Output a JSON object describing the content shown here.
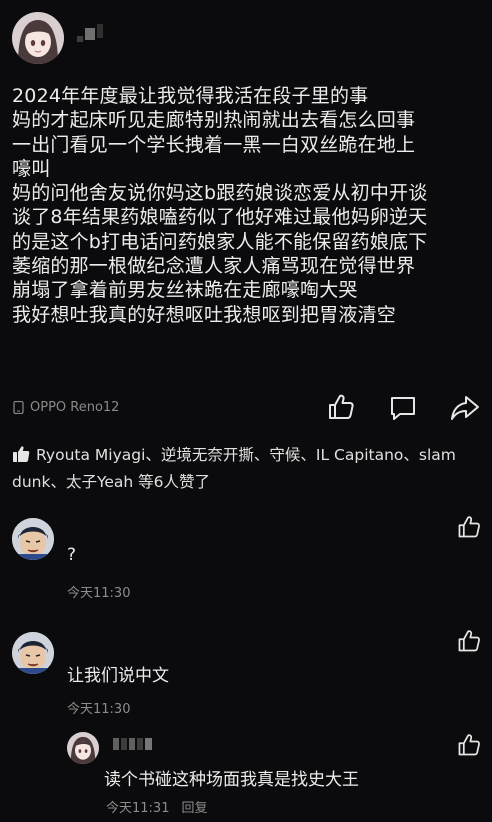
{
  "post": {
    "author_avatar": "anime-girl-avatar",
    "lines": [
      "2024年年度最让我觉得我活在段子里的事",
      "妈的才起床听见走廊特别热闹就出去看怎么回事",
      "一出门看见一个学长拽着一黑一白双丝跪在地上",
      "嚎叫",
      "妈的问他舍友说你妈这b跟药娘谈恋爱从初中开谈",
      "谈了8年结果药娘嗑药似了他好难过最他妈卵逆天",
      "的是这个b打电话问药娘家人能不能保留药娘底下",
      "萎缩的那一根做纪念遭人家人痛骂现在觉得世界",
      "崩塌了拿着前男友丝袜跪在走廊嚎啕大哭",
      "我好想吐我真的好想呕吐我想呕到把胃液清空"
    ],
    "device": "OPPO Reno12",
    "likes_text": "Ryouta Miyagi、逆境无奈开撕、守候、IL  Capitano、slam dunk、太子Yeah 等6人赞了"
  },
  "comments": [
    {
      "avatar": "anime-boy-avatar",
      "text": "?",
      "time": "今天11:30"
    },
    {
      "avatar": "anime-boy-avatar",
      "text": "让我们说中文",
      "time": "今天11:30"
    },
    {
      "avatar": "anime-girl-avatar",
      "text": "读个书碰这种场面我真是找史大王",
      "time": "今天11:31",
      "reply": "回复"
    }
  ],
  "colors": {
    "background": "#0b0b0d",
    "text": "#ececec",
    "muted": "#8c8c8c"
  }
}
